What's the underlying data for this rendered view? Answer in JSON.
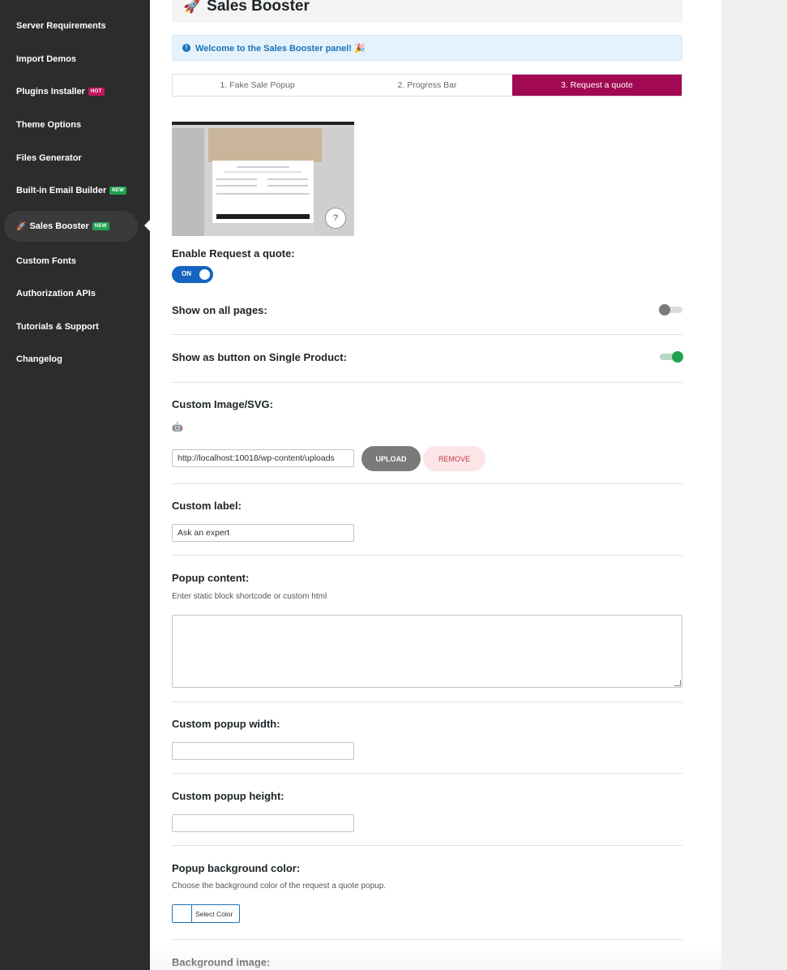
{
  "sidebar": {
    "items": [
      {
        "label": "Server Requirements"
      },
      {
        "label": "Import Demos"
      },
      {
        "label": "Plugins Installer",
        "badge": "HOT"
      },
      {
        "label": "Theme Options"
      },
      {
        "label": "Files Generator"
      },
      {
        "label": "Built-in Email Builder",
        "badge": "NEW"
      },
      {
        "label": "Sales Booster",
        "badge": "NEW",
        "icon": "🚀",
        "active": true
      },
      {
        "label": "Custom Fonts"
      },
      {
        "label": "Authorization APIs"
      },
      {
        "label": "Tutorials & Support"
      },
      {
        "label": "Changelog"
      }
    ]
  },
  "header": {
    "icon": "🚀",
    "title": "Sales Booster"
  },
  "notice": {
    "icon": "info-icon",
    "text": "Welcome to the Sales Booster panel! 🎉"
  },
  "tabs": [
    {
      "label": "1. Fake Sale Popup"
    },
    {
      "label": "2. Progress Bar"
    },
    {
      "label": "3. Request a quote",
      "active": true
    }
  ],
  "form": {
    "enable": {
      "label": "Enable Request a quote:",
      "toggle_text": "ON",
      "value": true
    },
    "show_all_pages": {
      "label": "Show on all pages:",
      "value": false
    },
    "show_as_button": {
      "label": "Show as button on Single Product:",
      "value": true
    },
    "custom_image": {
      "label": "Custom Image/SVG:",
      "icon": "🤖",
      "url_value": "http://localhost:10018/wp-content/uploads",
      "upload_label": "UPLOAD",
      "remove_label": "REMOVE"
    },
    "custom_label": {
      "label": "Custom label:",
      "value": "Ask an expert"
    },
    "popup_content": {
      "label": "Popup content:",
      "description": "Enter static block shortcode or custom html",
      "value": ""
    },
    "popup_width": {
      "label": "Custom popup width:",
      "value": ""
    },
    "popup_height": {
      "label": "Custom popup height:",
      "value": ""
    },
    "popup_bg_color": {
      "label": "Popup background color:",
      "description": "Choose the background color of the request a quote popup.",
      "button_label": "Select Color"
    },
    "background_image": {
      "label": "Background image:"
    }
  },
  "colors": {
    "sidebar_bg": "#2c2c2c",
    "active_tab": "#a10a52",
    "toggle_on": "#1565c0",
    "switch_green": "#20a150",
    "notice_bg": "#e5f2fb",
    "notice_text": "#1a73b8"
  }
}
